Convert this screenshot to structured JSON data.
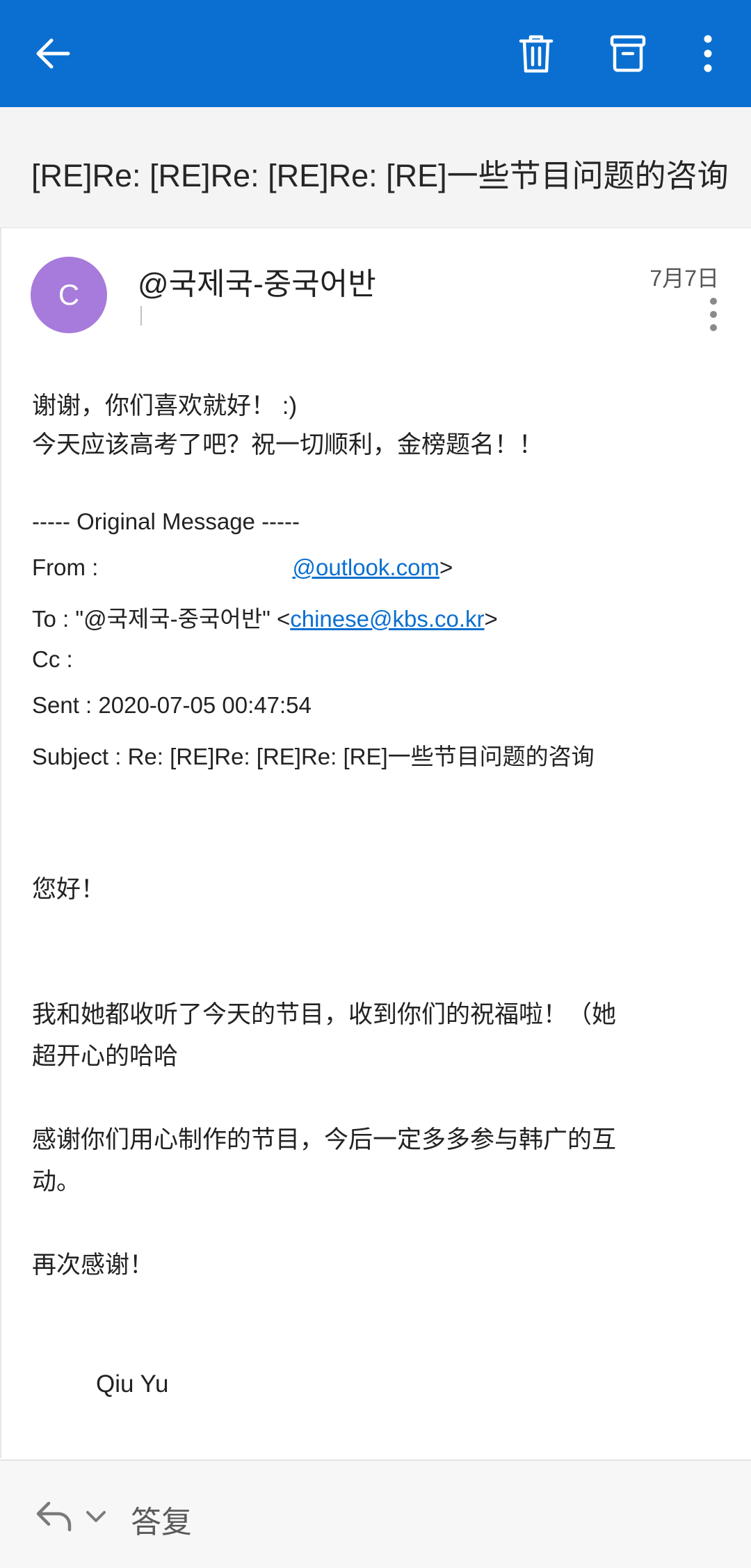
{
  "icons": {
    "back": "arrow-left",
    "delete": "trash-can",
    "archive": "archive-box",
    "more": "vertical-ellipsis",
    "reply": "reply-arrow",
    "expand": "chevron-down"
  },
  "colors": {
    "header_bg": "#0a6fd0",
    "avatar_bg": "#a77bdb",
    "link": "#0a6fd0"
  },
  "subject": "[RE]Re: [RE]Re: [RE]Re: [RE]一些节目问题的咨询",
  "message": {
    "avatar_letter": "C",
    "sender_name": "@국제국-중국어반",
    "date": "7月7日",
    "body_lines": [
      "谢谢，你们喜欢就好！ :)",
      "今天应该高考了吧？祝一切顺利，金榜题名！！"
    ],
    "original": {
      "divider": "----- Original Message -----",
      "from_label": "From : ",
      "from_link": "@outlook.com",
      "from_suffix": ">",
      "to_label": "To : \"@국제국-중국어반\" <",
      "to_link": "chinese@kbs.co.kr",
      "to_suffix": ">",
      "cc_label": "Cc :",
      "sent": "Sent : 2020-07-05 00:47:54",
      "subject": "Subject : Re: [RE]Re: [RE]Re: [RE]一些节目问题的咨询"
    },
    "quoted": {
      "greeting": "您好！",
      "p1_line1": "我和她都收听了今天的节目，收到你们的祝福啦！（她",
      "p1_line2": "超开心的哈哈",
      "p2_line1": "感谢你们用心制作的节目，今后一定多多参与韩广的互",
      "p2_line2": "动。",
      "p3": "再次感谢！",
      "signature": "Qiu Yu"
    }
  },
  "bottom": {
    "reply_label": "答复"
  }
}
